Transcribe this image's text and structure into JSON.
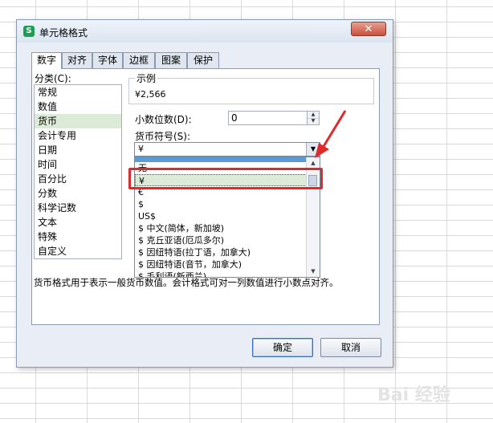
{
  "dialog": {
    "title": "单元格格式",
    "app_icon_letter": "S",
    "close_symbol": "✕"
  },
  "tabs": [
    {
      "label": "数字"
    },
    {
      "label": "对齐"
    },
    {
      "label": "字体"
    },
    {
      "label": "边框"
    },
    {
      "label": "图案"
    },
    {
      "label": "保护"
    }
  ],
  "category": {
    "label": "分类(C):",
    "selected": "货币",
    "items": [
      "常规",
      "数值",
      "货币",
      "会计专用",
      "日期",
      "时间",
      "百分比",
      "分数",
      "科学记数",
      "文本",
      "特殊",
      "自定义"
    ]
  },
  "sample": {
    "label": "示例",
    "value": "¥2,566"
  },
  "decimal": {
    "label": "小数位数(D):",
    "value": "0"
  },
  "currency": {
    "label": "货币符号(S):",
    "value": "¥",
    "options": [
      "",
      "无",
      "¥",
      "€",
      "$",
      "US$",
      "$ 中文(简体，新加坡)",
      "$ 克丘亚语(厄瓜多尔)",
      "$ 因纽特语(拉丁语，加拿大)",
      "$ 因纽特语(音节，加拿大)",
      "$ 毛利语(新西兰)"
    ]
  },
  "description": "货币格式用于表示一般货币数值。会计格式可对一列数值进行小数点对齐。",
  "buttons": {
    "ok": "确定",
    "cancel": "取消"
  },
  "watermark": "Bai 经验",
  "colors": {
    "highlight_box": "#e02a2a",
    "selected_row": "#dcebd7",
    "dropdown_highlight": "#5b9bd5"
  }
}
